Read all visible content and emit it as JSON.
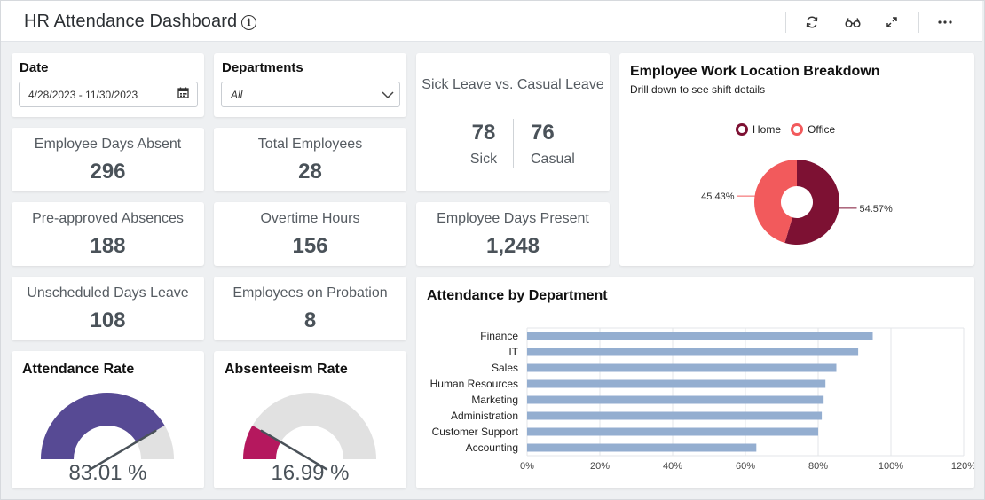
{
  "header": {
    "title": "HR Attendance Dashboard",
    "icons": [
      "info-icon",
      "refresh-icon",
      "glasses-icon",
      "expand-icon",
      "more-icon"
    ]
  },
  "filters": {
    "date": {
      "label": "Date",
      "value": "4/28/2023 - 11/30/2023",
      "icon": "calendar-icon"
    },
    "departments": {
      "label": "Departments",
      "value": "All",
      "icon": "chevron-down-icon"
    }
  },
  "kpis": {
    "days_absent": {
      "label": "Employee Days Absent",
      "value": "296"
    },
    "total_employees": {
      "label": "Total Employees",
      "value": "28"
    },
    "preapproved": {
      "label": "Pre-approved Absences",
      "value": "188"
    },
    "overtime": {
      "label": "Overtime Hours",
      "value": "156"
    },
    "days_present": {
      "label": "Employee Days Present",
      "value": "1,248"
    },
    "unscheduled": {
      "label": "Unscheduled Days Leave",
      "value": "108"
    },
    "probation": {
      "label": "Employees on Probation",
      "value": "8"
    }
  },
  "sick_casual": {
    "title": "Sick Leave vs. Casual Leave",
    "sick_value": "78",
    "sick_label": "Sick",
    "casual_value": "76",
    "casual_label": "Casual"
  },
  "gauges": {
    "attendance": {
      "title": "Attendance Rate",
      "value_text": "83.01 %",
      "value": 83.01,
      "color": "#574a94"
    },
    "absenteeism": {
      "title": "Absenteeism Rate",
      "value_text": "16.99 %",
      "value": 16.99,
      "color": "#b5185e"
    }
  },
  "location": {
    "title": "Employee Work Location Breakdown",
    "subtitle": "Drill down to see shift details",
    "chart_data": {
      "type": "pie",
      "series": [
        {
          "name": "Home",
          "value": 54.57,
          "label": "54.57%",
          "color": "#7d1133"
        },
        {
          "name": "Office",
          "value": 45.43,
          "label": "45.43%",
          "color": "#f25a5c"
        }
      ],
      "legend_position": "top"
    }
  },
  "attendance_dept": {
    "title": "Attendance by Department",
    "chart_data": {
      "type": "bar",
      "orientation": "horizontal",
      "categories": [
        "Finance",
        "IT",
        "Sales",
        "Human Resources",
        "Marketing",
        "Administration",
        "Customer Support",
        "Accounting"
      ],
      "values": [
        95,
        91,
        85,
        82,
        81.5,
        81,
        80,
        63
      ],
      "xlim": [
        0,
        120
      ],
      "x_ticks": [
        "0%",
        "20%",
        "40%",
        "60%",
        "80%",
        "100%",
        "120%"
      ],
      "grid": true,
      "bar_color": "#94aed0"
    }
  }
}
